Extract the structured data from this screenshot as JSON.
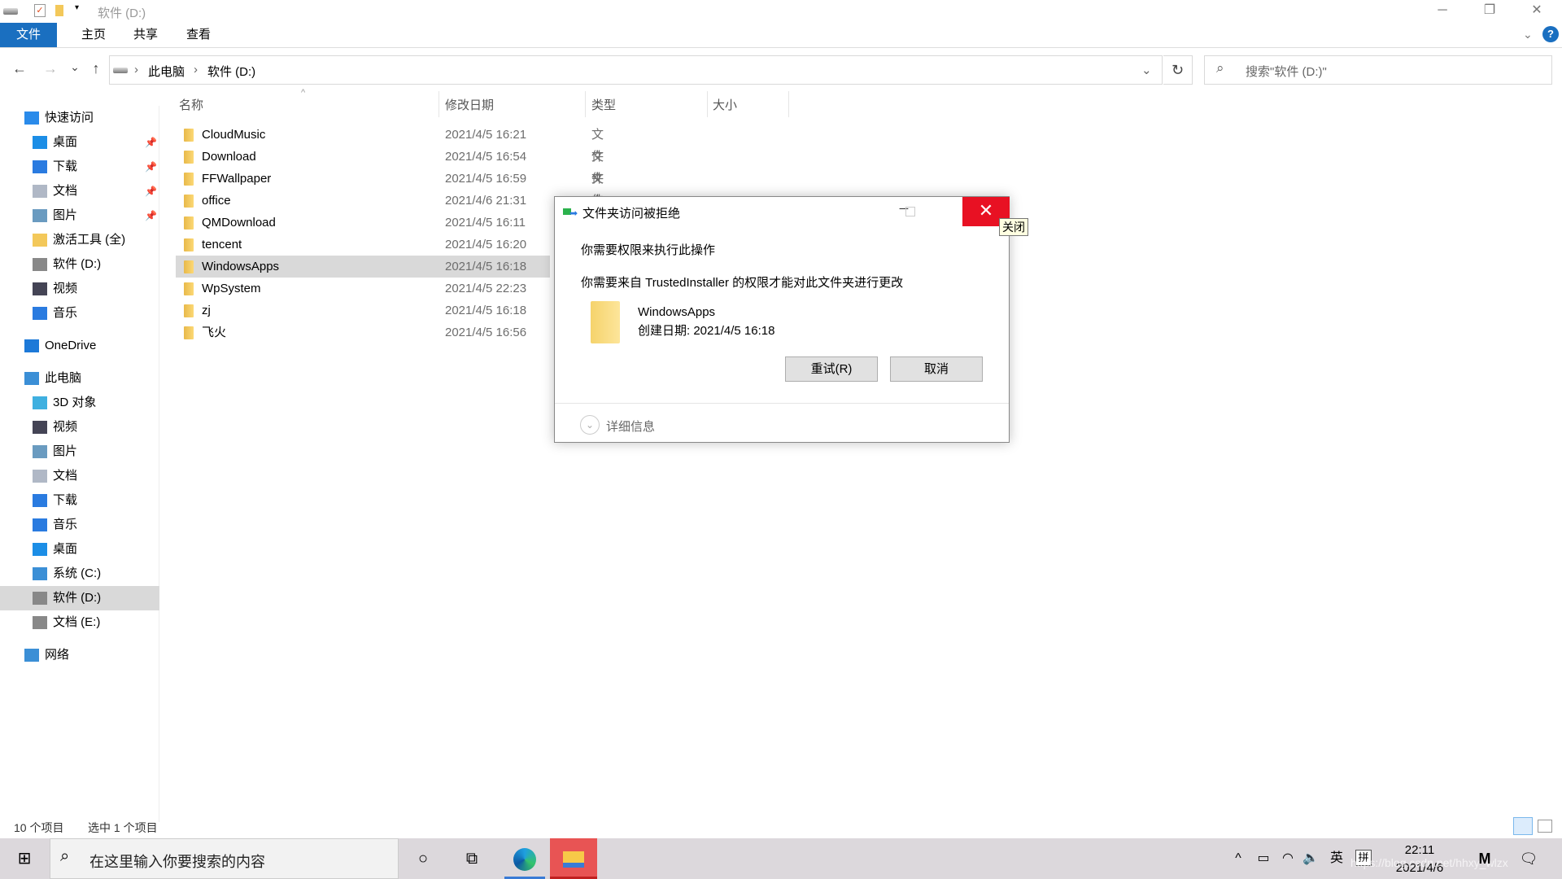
{
  "window": {
    "title": "软件 (D:)",
    "minimize": "─",
    "restore": "❐",
    "close": "✕"
  },
  "ribbon": {
    "tabs": [
      "文件",
      "主页",
      "共享",
      "查看"
    ],
    "help": "?"
  },
  "nav": {
    "back": "←",
    "forward": "→",
    "recent": "⌄",
    "up": "↑",
    "breadcrumb": [
      "此电脑",
      "软件 (D:)"
    ],
    "refresh": "↻",
    "search_placeholder": "搜索\"软件 (D:)\""
  },
  "sidebar": {
    "items": [
      {
        "label": "快速访问",
        "icon": "star-icon",
        "color": "#2a8bea"
      },
      {
        "label": "桌面",
        "icon": "desktop-icon",
        "pinned": true,
        "color": "#1c8ee6"
      },
      {
        "label": "下载",
        "icon": "download-icon",
        "pinned": true,
        "color": "#2a7be0"
      },
      {
        "label": "文档",
        "icon": "document-icon",
        "pinned": true,
        "color": "#b0b8c6"
      },
      {
        "label": "图片",
        "icon": "picture-icon",
        "pinned": true,
        "color": "#6a9bc0"
      },
      {
        "label": "激活工具 (全)",
        "icon": "folder-icon",
        "color": "#f3c85a"
      },
      {
        "label": "软件 (D:)",
        "icon": "drive-icon",
        "color": "#888"
      },
      {
        "label": "视频",
        "icon": "video-icon",
        "color": "#445"
      },
      {
        "label": "音乐",
        "icon": "music-icon",
        "color": "#2a7be0"
      },
      {
        "label": "OneDrive",
        "icon": "cloud-icon",
        "color": "#1d79d8"
      },
      {
        "label": "此电脑",
        "icon": "computer-icon",
        "color": "#3b8fd6"
      },
      {
        "label": "3D 对象",
        "icon": "cube-icon",
        "color": "#3fb0e0"
      },
      {
        "label": "视频",
        "icon": "video-icon",
        "color": "#445"
      },
      {
        "label": "图片",
        "icon": "picture-icon",
        "color": "#6a9bc0"
      },
      {
        "label": "文档",
        "icon": "document-icon",
        "color": "#b0b8c6"
      },
      {
        "label": "下载",
        "icon": "download-icon",
        "color": "#2a7be0"
      },
      {
        "label": "音乐",
        "icon": "music-icon",
        "color": "#2a7be0"
      },
      {
        "label": "桌面",
        "icon": "desktop-icon",
        "color": "#1c8ee6"
      },
      {
        "label": "系统 (C:)",
        "icon": "windows-drive-icon",
        "color": "#3b8fd6"
      },
      {
        "label": "软件 (D:)",
        "icon": "drive-icon",
        "color": "#888",
        "selected": true
      },
      {
        "label": "文档 (E:)",
        "icon": "drive-icon",
        "color": "#888"
      },
      {
        "label": "网络",
        "icon": "network-icon",
        "color": "#3b8fd6"
      }
    ]
  },
  "columns": [
    "名称",
    "修改日期",
    "类型",
    "大小"
  ],
  "files": [
    {
      "name": "CloudMusic",
      "date": "2021/4/5 16:21",
      "type": "文件夹"
    },
    {
      "name": "Download",
      "date": "2021/4/5 16:54",
      "type": "文件夹"
    },
    {
      "name": "FFWallpaper",
      "date": "2021/4/5 16:59",
      "type": "文件夹"
    },
    {
      "name": "office",
      "date": "2021/4/6 21:31",
      "type": ""
    },
    {
      "name": "QMDownload",
      "date": "2021/4/5 16:11",
      "type": ""
    },
    {
      "name": "tencent",
      "date": "2021/4/5 16:20",
      "type": ""
    },
    {
      "name": "WindowsApps",
      "date": "2021/4/5 16:18",
      "type": "",
      "selected": true
    },
    {
      "name": "WpSystem",
      "date": "2021/4/5 22:23",
      "type": ""
    },
    {
      "name": "zj",
      "date": "2021/4/5 16:18",
      "type": ""
    },
    {
      "name": "飞火",
      "date": "2021/4/5 16:56",
      "type": ""
    }
  ],
  "dialog": {
    "title": "文件夹访问被拒绝",
    "message1": "你需要权限来执行此操作",
    "message2": "你需要来自 TrustedInstaller 的权限才能对此文件夹进行更改",
    "item_name": "WindowsApps",
    "item_created": "创建日期: 2021/4/5 16:18",
    "retry": "重试(R)",
    "cancel": "取消",
    "details": "详细信息",
    "minimize": "─",
    "close": "✕",
    "tooltip": "关闭"
  },
  "status": {
    "count": "10 个项目",
    "selected": "选中 1 个项目"
  },
  "taskbar": {
    "search_placeholder": "在这里输入你要搜索的内容",
    "time": "22:11",
    "date": "2021/4/6",
    "ime_lang": "英",
    "ime_mode": "拼",
    "watermark": "https://blog.csdn.net/hhxy_wlzx"
  }
}
